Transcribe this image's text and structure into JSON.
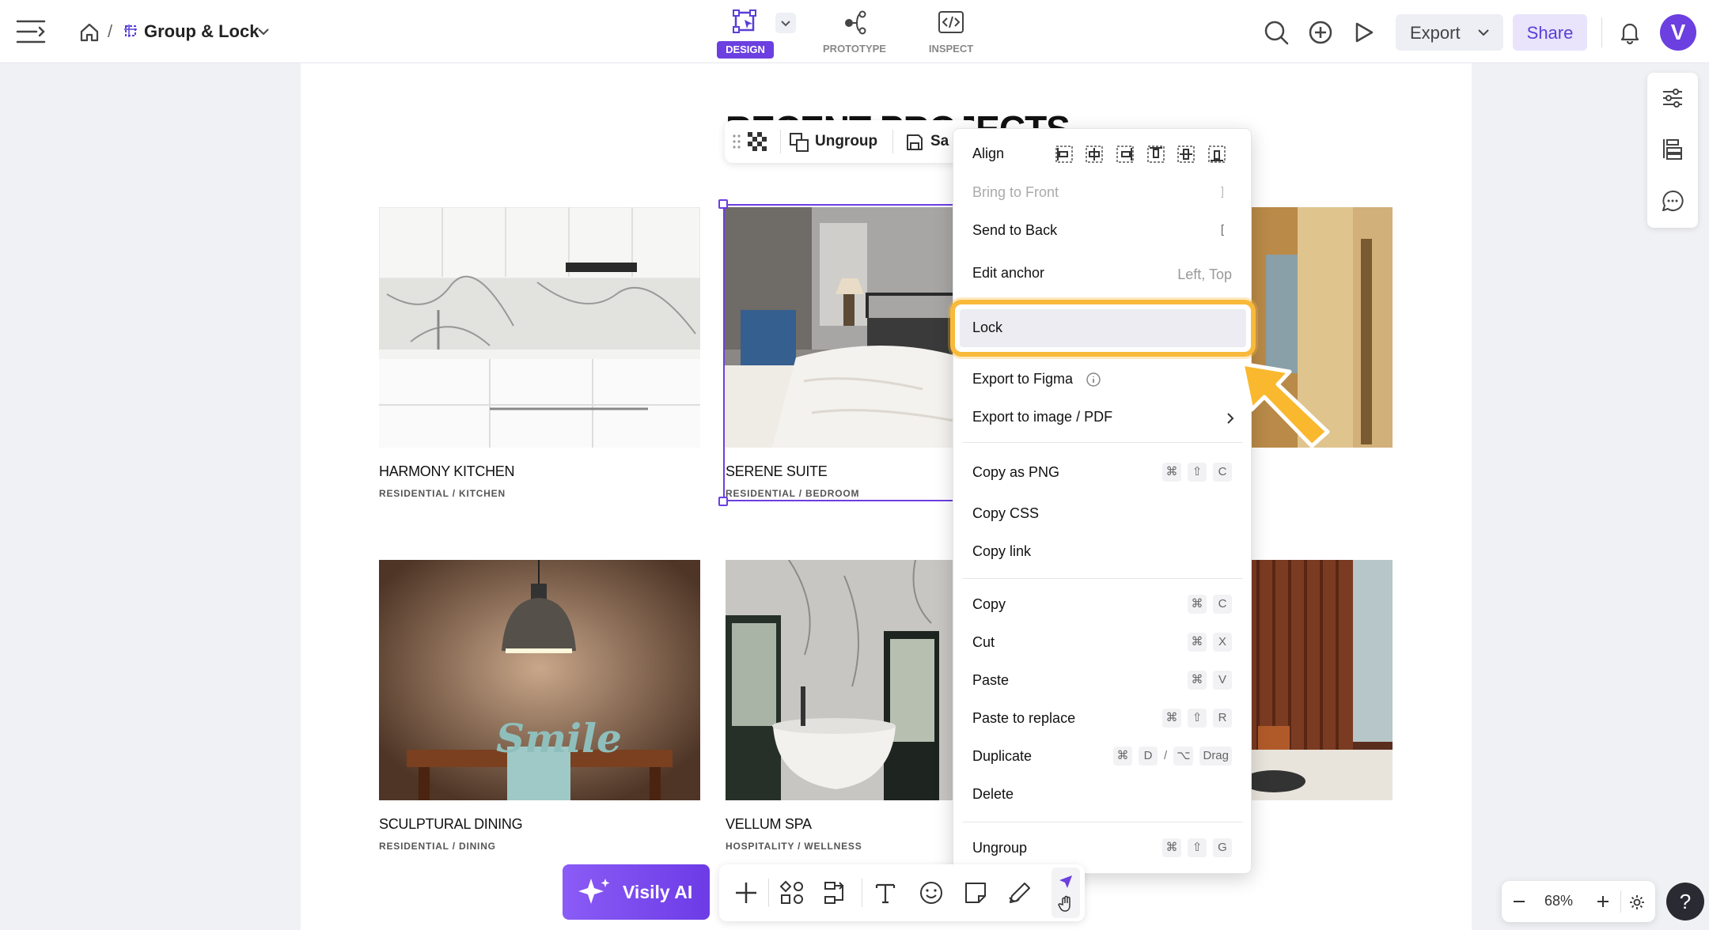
{
  "app": {
    "breadcrumb_sep": "/",
    "file_name": "Group & Lock",
    "accent": "#6b3fe0"
  },
  "modes": {
    "design": "DESIGN",
    "prototype": "PROTOTYPE",
    "inspect": "INSPECT"
  },
  "header": {
    "export_label": "Export",
    "share_label": "Share",
    "avatar_letter": "V"
  },
  "page_heading": "RECENT PROJECTS",
  "selection_toolbar": {
    "ungroup_label": "Ungroup",
    "save_label": "Sa"
  },
  "projects": [
    {
      "title": "HARMONY KITCHEN",
      "subtitle": "RESIDENTIAL / KITCHEN"
    },
    {
      "title": "SERENE SUITE",
      "subtitle": "RESIDENTIAL / BEDROOM"
    },
    {
      "title": "SCULPTURAL DINING",
      "subtitle": "RESIDENTIAL / DINING"
    },
    {
      "title": "VELLUM SPA",
      "subtitle": "HOSPITALITY / WELLNESS"
    }
  ],
  "dining_sign": "Smile",
  "context_menu": {
    "align": "Align",
    "bring_to_front": "Bring to Front",
    "bring_to_front_key": "]",
    "send_to_back": "Send to Back",
    "send_to_back_key": "[",
    "edit_anchor": "Edit anchor",
    "edit_anchor_value": "Left, Top",
    "lock": "Lock",
    "export_figma": "Export to Figma",
    "export_image": "Export to image / PDF",
    "copy_png": "Copy as PNG",
    "copy_css": "Copy CSS",
    "copy_link": "Copy link",
    "copy": "Copy",
    "cut": "Cut",
    "paste": "Paste",
    "paste_replace": "Paste to replace",
    "duplicate": "Duplicate",
    "delete": "Delete",
    "ungroup": "Ungroup",
    "keys": {
      "cmd": "⌘",
      "shift": "⇧",
      "opt": "⌥",
      "c": "C",
      "x": "X",
      "v": "V",
      "r": "R",
      "d": "D",
      "g": "G",
      "slash": "/",
      "drag": "Drag"
    }
  },
  "bottom": {
    "ai_label": "Visily AI",
    "zoom": "68%",
    "help": "?"
  }
}
